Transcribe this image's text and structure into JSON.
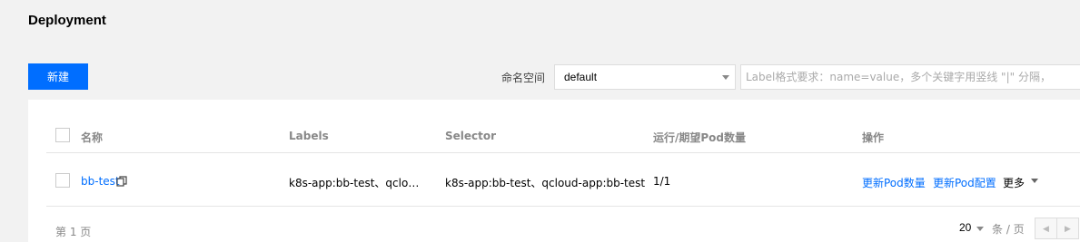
{
  "page": {
    "title": "Deployment"
  },
  "toolbar": {
    "create_label": "新建",
    "namespace_label": "命名空间",
    "namespace_value": "default",
    "label_search_placeholder": "Label格式要求：name=value，多个关键字用竖线 \"|\" 分隔，"
  },
  "table": {
    "columns": [
      "名称",
      "Labels",
      "Selector",
      "运行/期望Pod数量",
      "操作"
    ],
    "rows": [
      {
        "name": "bb-test",
        "labels": "k8s-app:bb-test、qcloud…",
        "selector": "k8s-app:bb-test、qcloud-app:bb-test",
        "pods": "1/1",
        "actions": [
          "更新Pod数量",
          "更新Pod配置",
          "更多"
        ]
      }
    ]
  },
  "footer": {
    "page_text": "第 1 页",
    "page_size": "20",
    "page_size_unit": "条 / 页"
  },
  "icons": {
    "copy": "copy-icon",
    "dropdown": "caret-down-icon",
    "prev": "prev-page-icon",
    "next": "next-page-icon"
  },
  "colors": {
    "accent": "#006eff",
    "background": "#f2f2f2"
  }
}
